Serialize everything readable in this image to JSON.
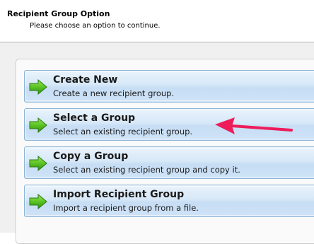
{
  "header": {
    "title": "Recipient Group Option",
    "subtitle": "Please choose an option to continue."
  },
  "options": [
    {
      "title": "Create New",
      "description": "Create a new recipient group.",
      "icon": "green-arrow-icon"
    },
    {
      "title": "Select a Group",
      "description": "Select an existing recipient group.",
      "icon": "green-arrow-icon"
    },
    {
      "title": "Copy a Group",
      "description": "Select an existing recipient group and copy it.",
      "icon": "green-arrow-icon"
    },
    {
      "title": "Import Recipient Group",
      "description": "Import a recipient group from a file.",
      "icon": "green-arrow-icon"
    }
  ],
  "colors": {
    "option_border": "#8fb6d6",
    "option_fill": "#d7e8f8",
    "arrow_green": "#4caf1e",
    "callout": "#ee1c5a"
  }
}
